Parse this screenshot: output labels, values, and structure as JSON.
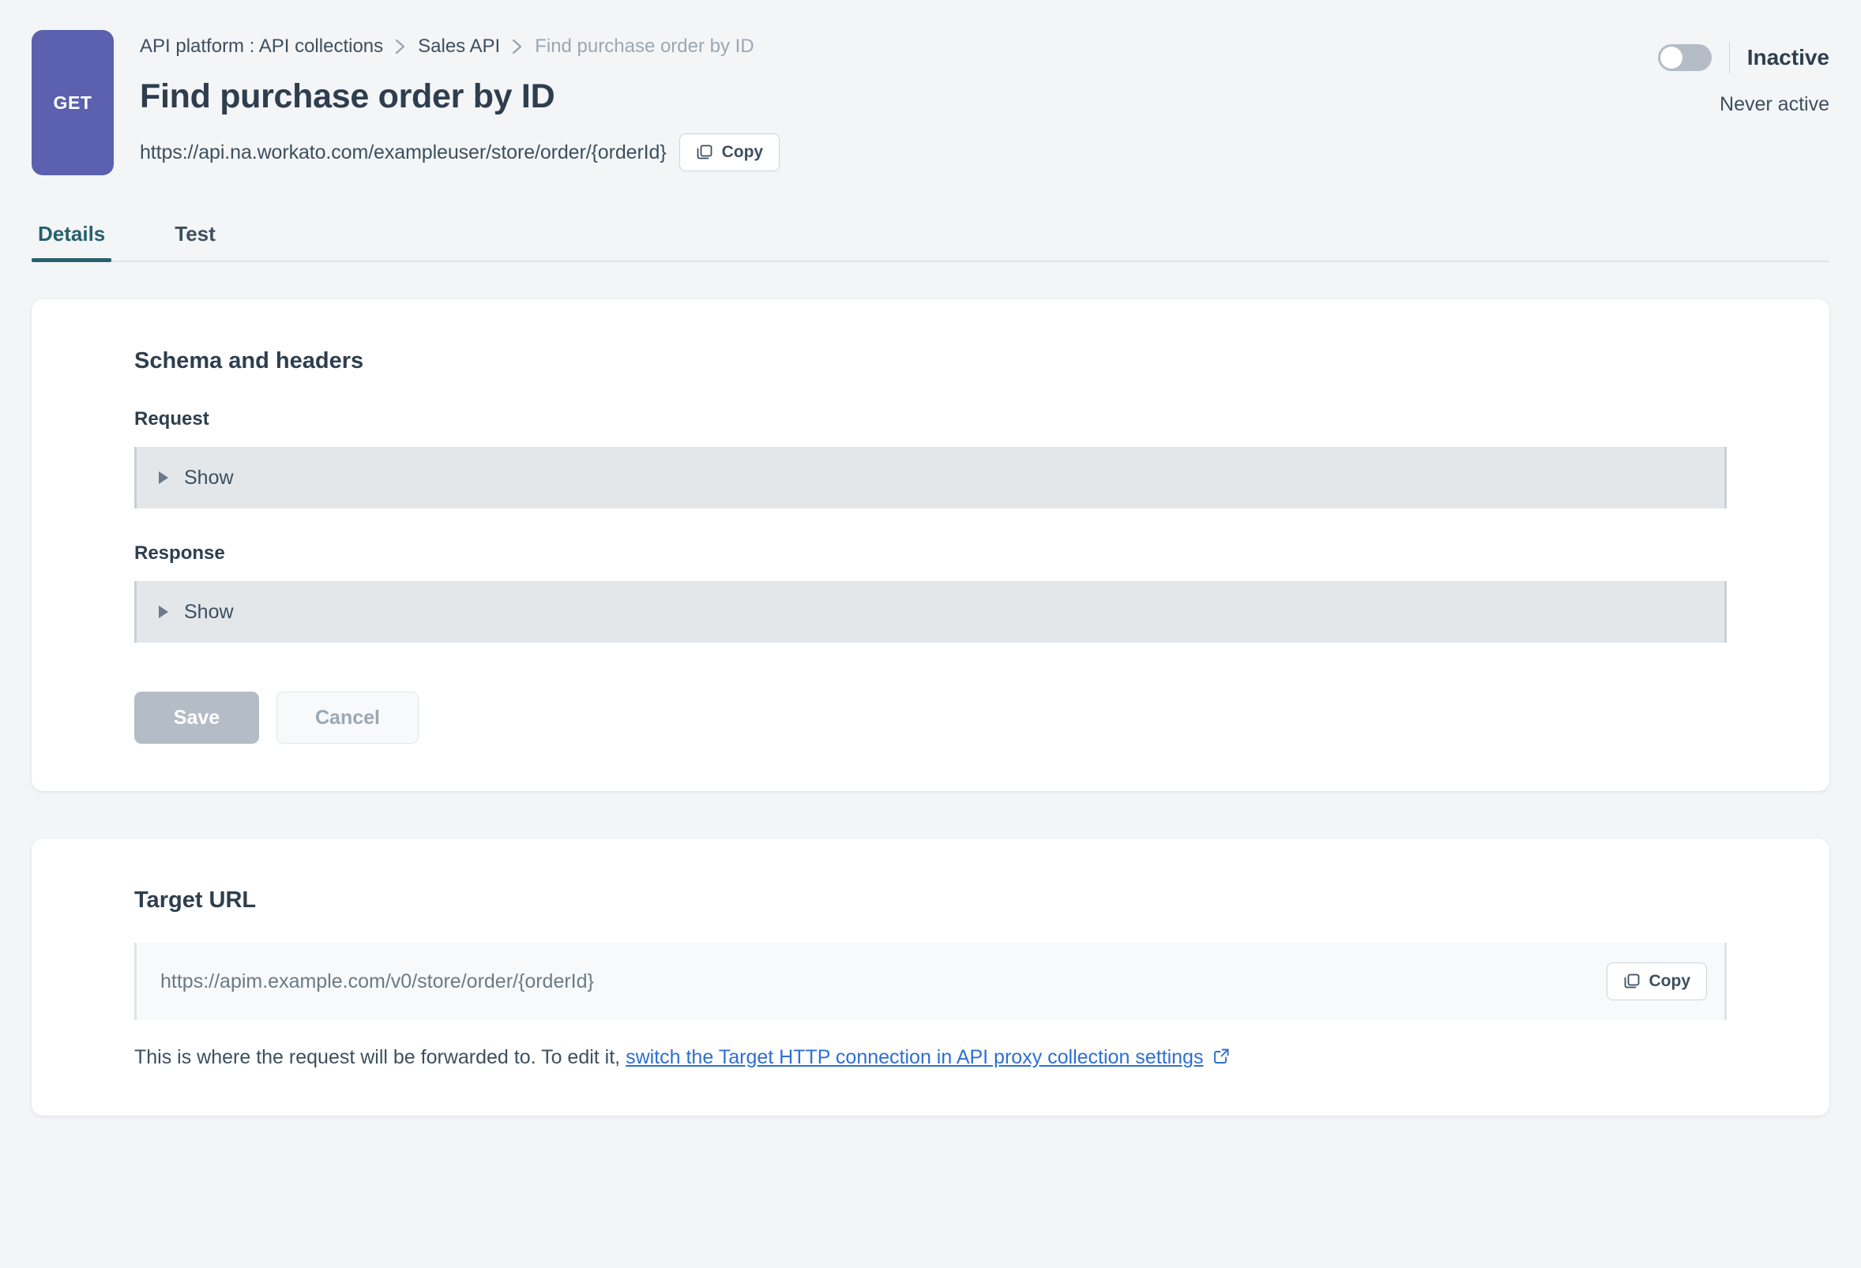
{
  "header": {
    "method_badge": "GET",
    "breadcrumb": [
      {
        "label": "API platform : API collections",
        "style": "link"
      },
      {
        "label": "Sales API",
        "style": "link"
      },
      {
        "label": "Find purchase order by ID",
        "style": "muted"
      }
    ],
    "title": "Find purchase order by ID",
    "api_url": "https://api.na.workato.com/exampleuser/store/order/{orderId}",
    "copy_label": "Copy",
    "copy_icon": "copy-icon",
    "toggle_state": "off",
    "toggle_label": "Inactive",
    "active_note": "Never active",
    "badge_color": "#5b61ae"
  },
  "tabs": [
    {
      "label": "Details",
      "active": true
    },
    {
      "label": "Test",
      "active": false
    }
  ],
  "schema_card": {
    "title": "Schema and headers",
    "request": {
      "label": "Request",
      "toggle_label": "Show",
      "expanded": false
    },
    "response": {
      "label": "Response",
      "toggle_label": "Show",
      "expanded": false
    },
    "save_label": "Save",
    "cancel_label": "Cancel",
    "save_disabled": true,
    "cancel_disabled": true
  },
  "target_card": {
    "title": "Target URL",
    "url_value": "https://apim.example.com/v0/store/order/{orderId}",
    "copy_label": "Copy",
    "copy_icon": "copy-icon",
    "help_prefix": "This is where the request will be forwarded to. To edit it,",
    "help_link": "switch the Target HTTP connection in API proxy collection settings",
    "help_link_icon": "external-link-icon"
  },
  "colors": {
    "page_bg": "#f4f5f7",
    "accent_teal": "#24616b",
    "link_blue": "#2f6fd0",
    "badge_purple": "#5b61ae",
    "text_dark": "#2e3e4e"
  }
}
